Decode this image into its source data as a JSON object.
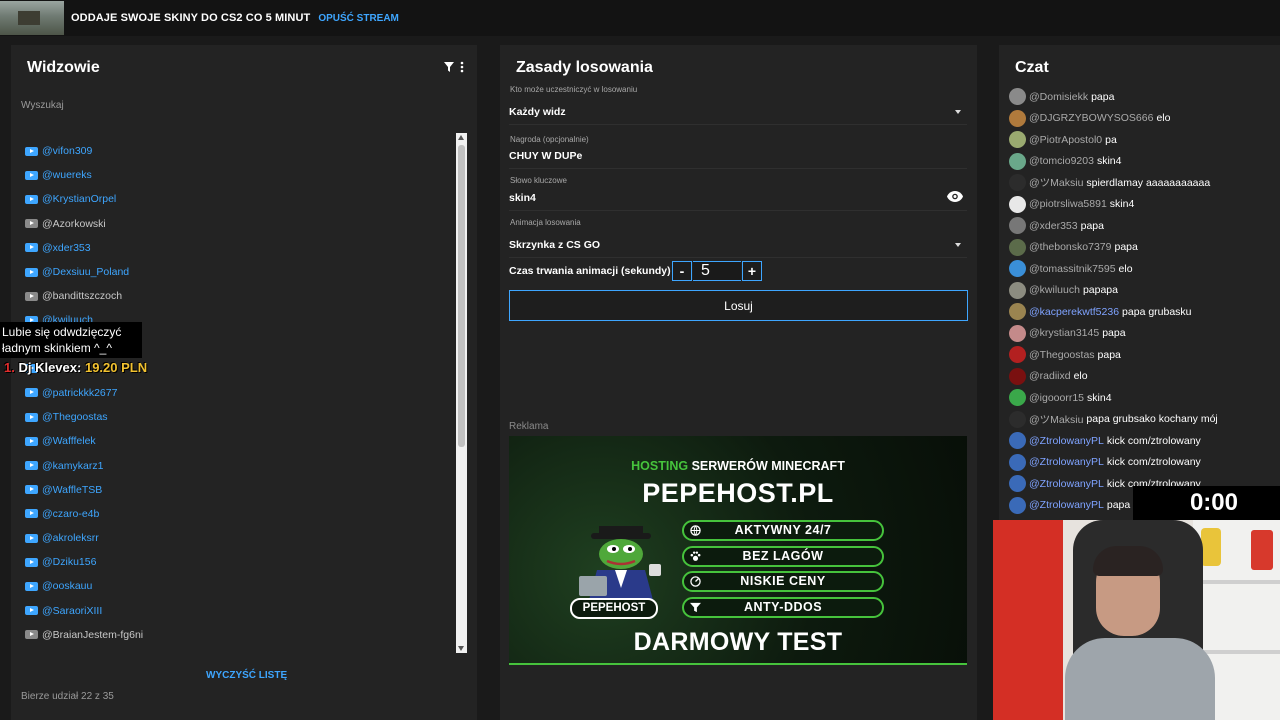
{
  "stream": {
    "title": "ODDAJE SWOJE SKINY DO CS2 CO 5 MINUT",
    "leave": "OPUŚĆ STREAM"
  },
  "viewers": {
    "title": "Widzowie",
    "search_placeholder": "Wyszukaj",
    "items": [
      {
        "name": "@vifon309",
        "yt": true
      },
      {
        "name": "@wuereks",
        "yt": true
      },
      {
        "name": "@KrystianOrpel",
        "yt": true
      },
      {
        "name": "@Azorkowski",
        "yt": false
      },
      {
        "name": "@xder353",
        "yt": true
      },
      {
        "name": "@Dexsiuu_Poland",
        "yt": true
      },
      {
        "name": "@bandittszczoch",
        "yt": false
      },
      {
        "name": "@kwiluuch",
        "yt": true
      },
      {
        "name": "",
        "yt": true
      },
      {
        "name": "",
        "yt": true
      },
      {
        "name": "@patrickkk2677",
        "yt": true
      },
      {
        "name": "@Thegoostas",
        "yt": true
      },
      {
        "name": "@Wafffelek",
        "yt": true
      },
      {
        "name": "@kamykarz1",
        "yt": true
      },
      {
        "name": "@WaffleTSB",
        "yt": true
      },
      {
        "name": "@czaro-e4b",
        "yt": true
      },
      {
        "name": "@akroleksrr",
        "yt": true
      },
      {
        "name": "@Dziku156",
        "yt": true
      },
      {
        "name": "@ooskauu",
        "yt": true
      },
      {
        "name": "@SaraoriXIII",
        "yt": true
      },
      {
        "name": "@BraianJestem-fg6ni",
        "yt": false
      }
    ],
    "clear_label": "WYCZYŚĆ LISTĘ",
    "count_text": "Bierze udział 22 z 35"
  },
  "donation": {
    "line1": "Lubie się odwdzięczyć",
    "line2": "ładnym skinkiem ^_^",
    "rank": "1.",
    "name": "Dj Klevex:",
    "amount": "19.20 PLN"
  },
  "rules": {
    "title": "Zasady losowania",
    "who_label": "Kto może uczestniczyć w losowaniu",
    "who_value": "Każdy widz",
    "prize_label": "Nagroda (opcjonalnie)",
    "prize_value": "CHUY W DUPe",
    "keyword_label": "Słowo kluczowe",
    "keyword_value": "skin4",
    "anim_label": "Animacja losowania",
    "anim_value": "Skrzynka z CS GO",
    "duration_label": "Czas trwania animacji (sekundy)",
    "duration_minus": "-",
    "duration_value": "5",
    "duration_plus": "+",
    "draw_label": "Losuj",
    "ad_label": "Reklama"
  },
  "ad": {
    "h1_green": "HOSTING",
    "h1_rest": "SERWERÓW MINECRAFT",
    "h2": "PEPEHOST.PL",
    "features": [
      "AKTYWNY 24/7",
      "BEZ LAGÓW",
      "NISKIE CENY",
      "ANTY-DDOS"
    ],
    "brand": "PEPEHOST",
    "cta": "DARMOWY TEST",
    "accent": "#46c33c"
  },
  "chat": {
    "title": "Czat",
    "messages": [
      {
        "user": "@Domisiekk",
        "msg": "papa",
        "av": "#8a8a8a",
        "blue": false
      },
      {
        "user": "@DJGRZYBOWYSOS666",
        "msg": "elo",
        "av": "#b07a3c",
        "blue": false
      },
      {
        "user": "@PiotrApostol0",
        "msg": "pa",
        "av": "#9aaa70",
        "blue": false
      },
      {
        "user": "@tomcio9203",
        "msg": "skin4",
        "av": "#6aa88a",
        "blue": false
      },
      {
        "user": "@ツMaksiu",
        "msg": "spierdlamay aaaaaaaaaaa",
        "av": "#2c2c2c",
        "blue": false
      },
      {
        "user": "@piotrsliwa5891",
        "msg": "skin4",
        "av": "#e8e8e8",
        "blue": false
      },
      {
        "user": "@xder353",
        "msg": "papa",
        "av": "#777777",
        "blue": false
      },
      {
        "user": "@thebonsko7379",
        "msg": "papa",
        "av": "#5b6b4a",
        "blue": false
      },
      {
        "user": "@tomassitnik7595",
        "msg": "elo",
        "av": "#3a8fd8",
        "blue": false
      },
      {
        "user": "@kwiluuch",
        "msg": "papapa",
        "av": "#8c8c80",
        "blue": false
      },
      {
        "user": "@kacperekwtf5236",
        "msg": "papa grubasku",
        "av": "#9a8450",
        "blue": true
      },
      {
        "user": "@krystian3145",
        "msg": "papa",
        "av": "#c48a8a",
        "blue": false
      },
      {
        "user": "@Thegoostas",
        "msg": "papa",
        "av": "#b32020",
        "blue": false
      },
      {
        "user": "@radiixd",
        "msg": "elo",
        "av": "#7a1010",
        "blue": false
      },
      {
        "user": "@igooorr15",
        "msg": "skin4",
        "av": "#3aa84a",
        "blue": false
      },
      {
        "user": "@ツMaksiu",
        "msg": "papa grubsako kochany mój",
        "av": "#2c2c2c",
        "blue": false
      },
      {
        "user": "@ZtrolowanyPL",
        "msg": "kick com/ztrolowany",
        "av": "#3a6ab8",
        "blue": true
      },
      {
        "user": "@ZtrolowanyPL",
        "msg": "kick com/ztrolowany",
        "av": "#3a6ab8",
        "blue": true
      },
      {
        "user": "@ZtrolowanyPL",
        "msg": "kick com/ztrolowany",
        "av": "#3a6ab8",
        "blue": true
      },
      {
        "user": "@ZtrolowanyPL",
        "msg": "papa",
        "av": "#3a6ab8",
        "blue": true
      }
    ]
  },
  "timer": "0:00",
  "colors": {
    "accent": "#3ea6ff",
    "panel": "#232323",
    "bg": "#1a1a1a"
  }
}
